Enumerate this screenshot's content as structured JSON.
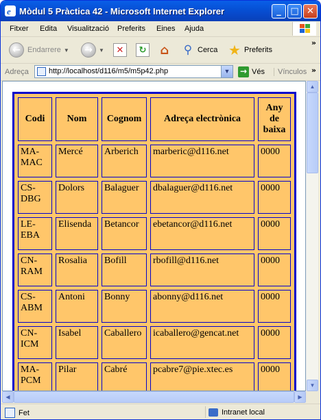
{
  "window": {
    "title": "Mòdul 5 Pràctica 42 - Microsoft Internet Explorer",
    "min_glyph": "_",
    "max_glyph": "□",
    "close_glyph": "✕"
  },
  "menu": {
    "items": [
      "Fitxer",
      "Edita",
      "Visualització",
      "Preferits",
      "Eines",
      "Ajuda"
    ]
  },
  "toolbar": {
    "back_label": "Endarrere",
    "search_label": "Cerca",
    "favorites_label": "Preferits",
    "more": "»"
  },
  "address": {
    "label": "Adreça",
    "url": "http://localhost/d116/m5/m5p42.php",
    "go_label": "Vés",
    "links_label": "Vínculos",
    "links_more": "»"
  },
  "table": {
    "headers": [
      "Codi",
      "Nom",
      "Cognom",
      "Adreça electrònica",
      "Any de baixa"
    ],
    "rows": [
      [
        "MA-MAC",
        "Mercé",
        "Arberich",
        "marberic@d116.net",
        "0000"
      ],
      [
        "CS-DBG",
        "Dolors",
        "Balaguer",
        "dbalaguer@d116.net",
        "0000"
      ],
      [
        "LE-EBA",
        "Elisenda",
        "Betancor",
        "ebetancor@d116.net",
        "0000"
      ],
      [
        "CN-RAM",
        "Rosalia",
        "Bofill",
        "rbofill@d116.net",
        "0000"
      ],
      [
        "CS-ABM",
        "Antoni",
        "Bonny",
        "abonny@d116.net",
        "0000"
      ],
      [
        "CN-ICM",
        "Isabel",
        "Caballero",
        "icaballero@gencat.net",
        "0000"
      ],
      [
        "MA-PCM",
        "Pilar",
        "Cabré",
        "pcabre7@pie.xtec.es",
        "0000"
      ]
    ]
  },
  "status": {
    "text": "Fet",
    "zone": "Intranet local"
  },
  "colors": {
    "table_bg": "#ffc66a",
    "table_border": "#0000cc",
    "titlebar": "#0a5fe8"
  }
}
